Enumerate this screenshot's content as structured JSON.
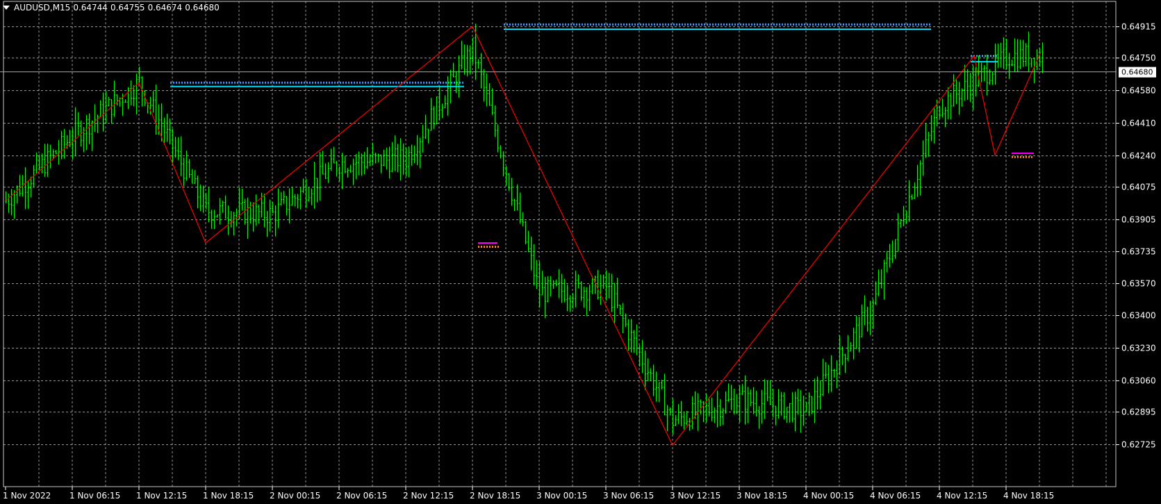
{
  "header": {
    "symbol_timeframe": "AUDUSD,M15",
    "open": "0.64744",
    "high": "0.64755",
    "low": "0.64674",
    "close": "0.64680"
  },
  "colors": {
    "background": "#000000",
    "grid": "#c8c8c8",
    "candles": "#00ff00",
    "zigzag": "#ff0000",
    "resistance_solid": "#00e5ff",
    "resistance_dotted": "#3a9bff",
    "support_solid": "#ff00ff",
    "support_dotted": "#ff7f27",
    "current_price_line": "#8aa8c8"
  },
  "chart_data": {
    "type": "line",
    "title": "AUDUSD,M15",
    "ylim": [
      0.6265,
      0.65
    ],
    "y_ticks": [
      "0.64915",
      "0.64750",
      "0.64580",
      "0.64410",
      "0.64240",
      "0.64075",
      "0.63905",
      "0.63735",
      "0.63570",
      "0.63400",
      "0.63230",
      "0.63060",
      "0.62895",
      "0.62725"
    ],
    "x_ticks": [
      "1 Nov 2022",
      "1 Nov 06:15",
      "1 Nov 12:15",
      "1 Nov 18:15",
      "2 Nov 00:15",
      "2 Nov 06:15",
      "2 Nov 12:15",
      "2 Nov 18:15",
      "3 Nov 00:15",
      "3 Nov 06:15",
      "3 Nov 12:15",
      "3 Nov 18:15",
      "4 Nov 00:15",
      "4 Nov 06:15",
      "4 Nov 12:15",
      "4 Nov 18:15"
    ],
    "current_price": "0.64680",
    "price_keypoints": [
      {
        "x": "1 Nov 2022",
        "y": 0.64
      },
      {
        "x": "1 Nov 06:15",
        "y": 0.6434
      },
      {
        "x": "1 Nov 12:15",
        "y": 0.6462
      },
      {
        "x": "1 Nov 18:15",
        "y": 0.6395
      },
      {
        "x": "2 Nov 00:15",
        "y": 0.6393
      },
      {
        "x": "2 Nov 06:15",
        "y": 0.642
      },
      {
        "x": "2 Nov 12:15",
        "y": 0.6422
      },
      {
        "x": "2 Nov 18:15",
        "y": 0.648
      },
      {
        "x": "3 Nov 00:15",
        "y": 0.6352
      },
      {
        "x": "3 Nov 06:15",
        "y": 0.6355
      },
      {
        "x": "3 Nov 12:15",
        "y": 0.6285
      },
      {
        "x": "3 Nov 18:15",
        "y": 0.6296
      },
      {
        "x": "4 Nov 00:15",
        "y": 0.629
      },
      {
        "x": "4 Nov 06:15",
        "y": 0.6345
      },
      {
        "x": "4 Nov 12:15",
        "y": 0.645
      },
      {
        "x": "4 Nov 18:15",
        "y": 0.6475
      }
    ],
    "zigzag": [
      {
        "x": "1 Nov 2022",
        "y": 0.64
      },
      {
        "x": "1 Nov 12:15",
        "y": 0.6462
      },
      {
        "x": "1 Nov 18:15",
        "y": 0.6378
      },
      {
        "x": "2 Nov 18:15",
        "y": 0.64915
      },
      {
        "x": "3 Nov 12:15",
        "y": 0.6272
      },
      {
        "x": "4 Nov 12:15",
        "y": 0.6476
      },
      {
        "x": "4 Nov 12:15",
        "y": 0.6424
      },
      {
        "x": "4 Nov 18:15",
        "y": 0.6478
      }
    ],
    "levels": [
      {
        "kind": "resistance",
        "style": "solid",
        "y": 0.646,
        "from": "1 Nov 12:15",
        "to": "2 Nov 18:15"
      },
      {
        "kind": "resistance",
        "style": "dotted",
        "y": 0.6462,
        "from": "1 Nov 12:15",
        "to": "2 Nov 18:15"
      },
      {
        "kind": "resistance",
        "style": "solid",
        "y": 0.649,
        "from": "2 Nov 18:15",
        "to": "4 Nov 12:15"
      },
      {
        "kind": "resistance",
        "style": "dotted",
        "y": 0.64925,
        "from": "2 Nov 18:15",
        "to": "4 Nov 12:15"
      },
      {
        "kind": "resistance",
        "style": "solid",
        "y": 0.6473,
        "from": "4 Nov 12:15",
        "to": "4 Nov 18:15"
      },
      {
        "kind": "resistance",
        "style": "dotted",
        "y": 0.6476,
        "from": "4 Nov 12:15",
        "to": "4 Nov 18:15"
      },
      {
        "kind": "support",
        "style": "solid",
        "y": 0.6378,
        "from": "2 Nov 18:15",
        "to": "3 Nov 00:15"
      },
      {
        "kind": "support",
        "style": "dotted",
        "y": 0.6376,
        "from": "2 Nov 18:15",
        "to": "2 Nov 18:15"
      },
      {
        "kind": "support",
        "style": "solid",
        "y": 0.6425,
        "from": "4 Nov 18:15",
        "to": "4 Nov 18:15"
      },
      {
        "kind": "support",
        "style": "dotted",
        "y": 0.6423,
        "from": "4 Nov 18:15",
        "to": "4 Nov 18:15"
      }
    ]
  }
}
